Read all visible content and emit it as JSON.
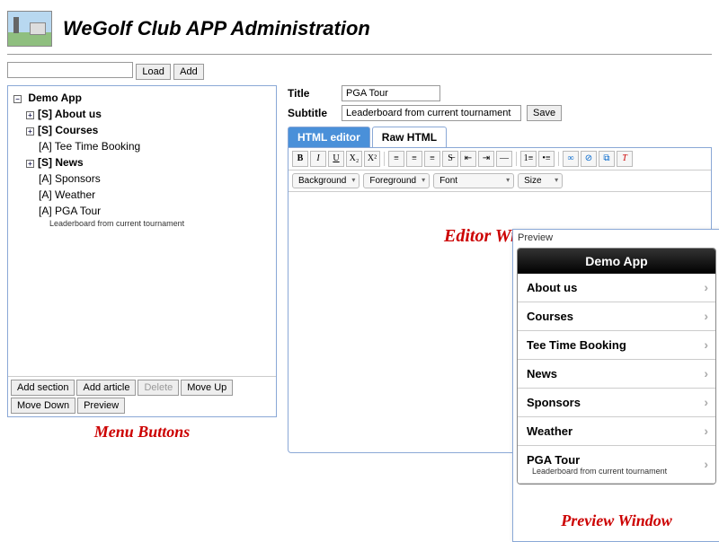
{
  "header": {
    "title": "WeGolf Club APP Administration"
  },
  "topbar": {
    "load": "Load",
    "add": "Add"
  },
  "tree": {
    "root": "Demo App",
    "items": [
      {
        "label": "[S] About us",
        "bold": true,
        "expandable": true
      },
      {
        "label": "[S] Courses",
        "bold": true,
        "expandable": true
      },
      {
        "label": "[A] Tee Time Booking",
        "bold": false,
        "expandable": false
      },
      {
        "label": "[S] News",
        "bold": true,
        "expandable": true
      },
      {
        "label": "[A] Sponsors",
        "bold": false,
        "expandable": false
      },
      {
        "label": "[A] Weather",
        "bold": false,
        "expandable": false
      },
      {
        "label": "[A] PGA Tour",
        "bold": false,
        "expandable": false,
        "sub": "Leaderboard from current tournament"
      }
    ],
    "buttons": {
      "add_section": "Add section",
      "add_article": "Add article",
      "delete": "Delete",
      "move_up": "Move Up",
      "move_down": "Move Down",
      "preview": "Preview"
    }
  },
  "annotations": {
    "menu": "Menu Buttons",
    "editor": "Editor Window",
    "preview": "Preview Window"
  },
  "editor": {
    "title_label": "Title",
    "title_value": "PGA Tour",
    "subtitle_label": "Subtitle",
    "subtitle_value": "Leaderboard from current tournament",
    "save": "Save",
    "tabs": {
      "html_editor": "HTML editor",
      "raw_html": "Raw HTML"
    },
    "selects": {
      "background": "Background",
      "foreground": "Foreground",
      "font": "Font",
      "size": "Size"
    }
  },
  "preview": {
    "title": "Preview",
    "app_title": "Demo App",
    "items": [
      {
        "label": "About us"
      },
      {
        "label": "Courses"
      },
      {
        "label": "Tee Time Booking"
      },
      {
        "label": "News"
      },
      {
        "label": "Sponsors"
      },
      {
        "label": "Weather"
      },
      {
        "label": "PGA Tour",
        "sub": "Leaderboard from current tournament"
      }
    ]
  }
}
